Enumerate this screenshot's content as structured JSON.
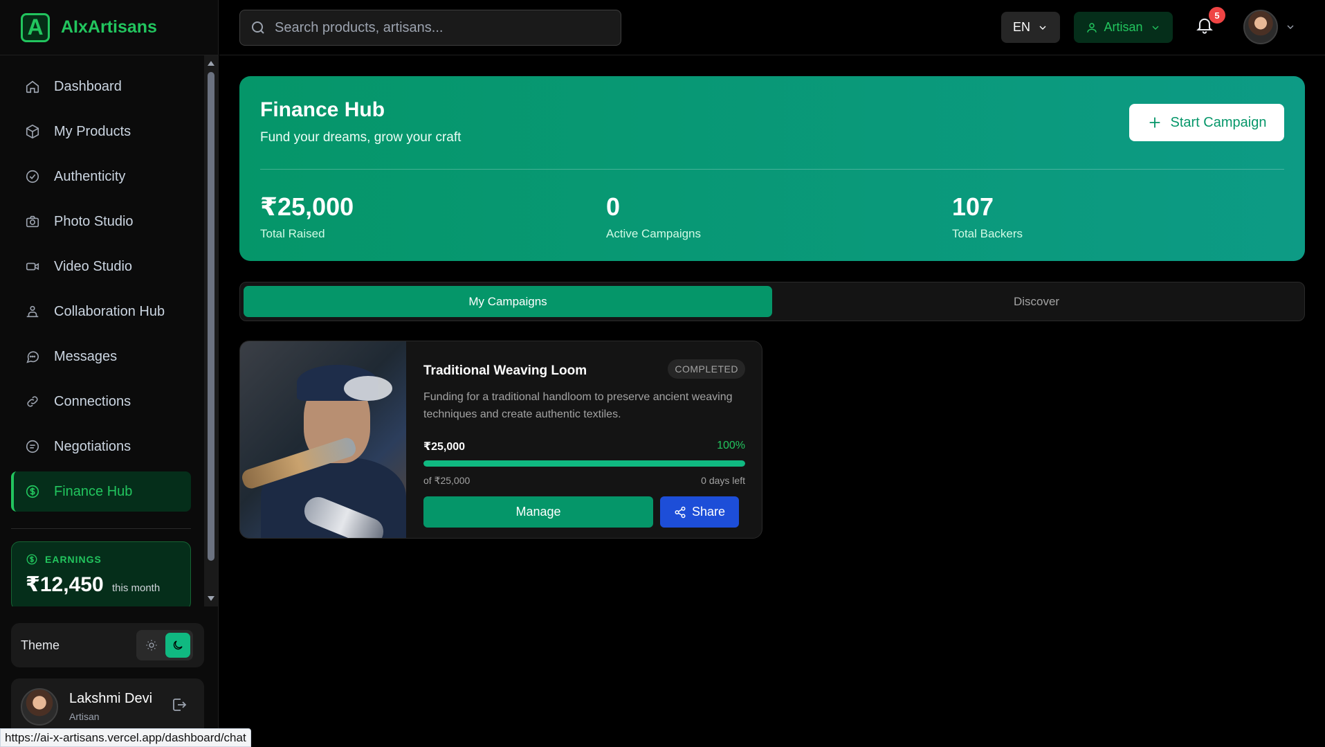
{
  "brand": {
    "logo_letter": "A",
    "name": "AIxArtisans",
    "accent": "#22c55e"
  },
  "sidebar": {
    "items": [
      {
        "label": "Dashboard",
        "icon": "home-icon"
      },
      {
        "label": "My Products",
        "icon": "box-icon"
      },
      {
        "label": "Authenticity",
        "icon": "check-circle-icon"
      },
      {
        "label": "Photo Studio",
        "icon": "camera-icon"
      },
      {
        "label": "Video Studio",
        "icon": "video-icon"
      },
      {
        "label": "Collaboration Hub",
        "icon": "users-icon"
      },
      {
        "label": "Messages",
        "icon": "chat-icon"
      },
      {
        "label": "Connections",
        "icon": "link-icon"
      },
      {
        "label": "Negotiations",
        "icon": "handshake-icon"
      },
      {
        "label": "Finance Hub",
        "icon": "dollar-icon",
        "active": true
      }
    ],
    "earnings": {
      "label": "EARNINGS",
      "amount": "₹12,450",
      "period": "this month"
    },
    "theme": {
      "label": "Theme",
      "selected": "dark"
    },
    "user": {
      "name": "Lakshmi Devi",
      "role": "Artisan"
    }
  },
  "header": {
    "search_placeholder": "Search products, artisans...",
    "language": "EN",
    "role": "Artisan",
    "notifications_count": "5"
  },
  "hero": {
    "title": "Finance Hub",
    "subtitle": "Fund your dreams, grow your craft",
    "cta": "Start Campaign",
    "stats": [
      {
        "value": "₹25,000",
        "label": "Total Raised"
      },
      {
        "value": "0",
        "label": "Active Campaigns"
      },
      {
        "value": "107",
        "label": "Total Backers"
      }
    ]
  },
  "tabs": [
    {
      "label": "My Campaigns",
      "active": true
    },
    {
      "label": "Discover",
      "active": false
    }
  ],
  "campaign": {
    "title": "Traditional Weaving Loom",
    "status": "COMPLETED",
    "description": "Funding for a traditional handloom to preserve ancient weaving techniques and create authentic textiles.",
    "raised": "₹25,000",
    "percent": "100%",
    "progress_fraction": 1.0,
    "goal": "of ₹25,000",
    "days_left": "0 days left",
    "manage_label": "Manage",
    "share_label": "Share"
  },
  "status_bar_url": "https://ai-x-artisans.vercel.app/dashboard/chat"
}
